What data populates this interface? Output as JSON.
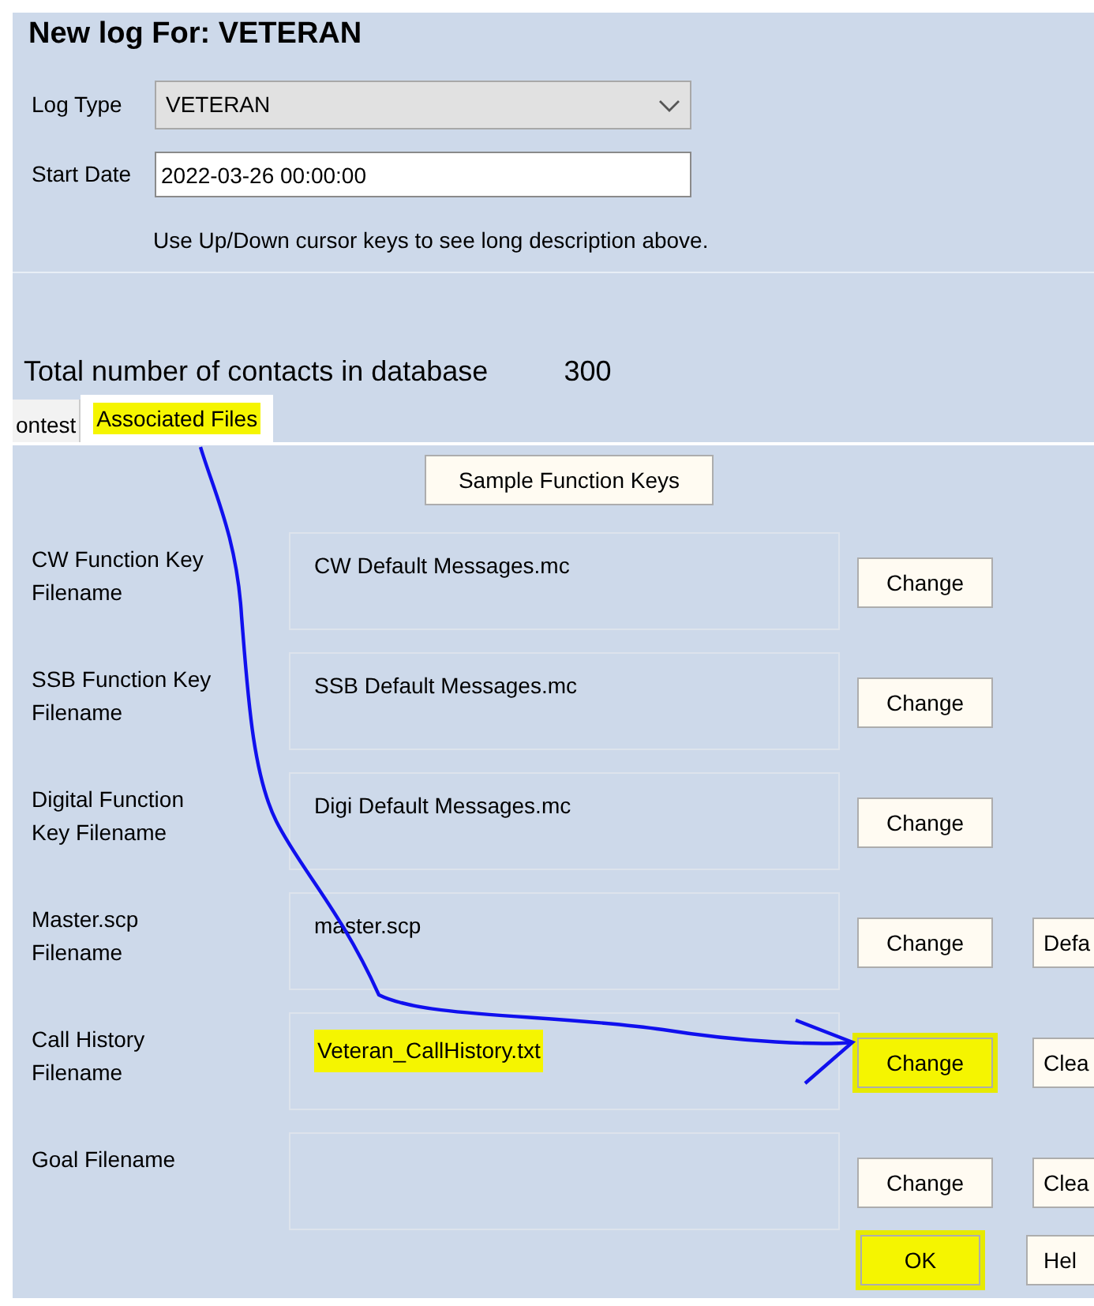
{
  "title": "New log For: VETERAN",
  "log_type": {
    "label": "Log Type",
    "value": "VETERAN"
  },
  "start_date": {
    "label": "Start Date",
    "value": "2022-03-26 00:00:00"
  },
  "hint": "Use Up/Down cursor keys to see long description above.",
  "contacts": {
    "label": "Total number of contacts in database",
    "value": "300"
  },
  "tabs": [
    {
      "label": "ontest",
      "selected": false,
      "highlighted": false
    },
    {
      "label": "Associated Files",
      "selected": true,
      "highlighted": true
    }
  ],
  "sample_button": "Sample Function Keys",
  "files": [
    {
      "label_lines": [
        "CW Function Key",
        "Filename"
      ],
      "value": "CW Default Messages.mc",
      "highlighted": false,
      "change": {
        "label": "Change",
        "highlighted": false
      }
    },
    {
      "label_lines": [
        "SSB Function Key",
        "Filename"
      ],
      "value": "SSB Default Messages.mc",
      "highlighted": false,
      "change": {
        "label": "Change",
        "highlighted": false
      }
    },
    {
      "label_lines": [
        "Digital Function",
        "Key Filename"
      ],
      "value": "Digi Default Messages.mc",
      "highlighted": false,
      "change": {
        "label": "Change",
        "highlighted": false
      }
    },
    {
      "label_lines": [
        "Master.scp",
        "Filename"
      ],
      "value": "master.scp",
      "highlighted": false,
      "change": {
        "label": "Change",
        "highlighted": false
      },
      "extra": "Defa"
    },
    {
      "label_lines": [
        "Call History",
        "Filename"
      ],
      "value": "Veteran_CallHistory.txt",
      "highlighted": true,
      "change": {
        "label": "Change",
        "highlighted": true
      },
      "extra": "Clea"
    },
    {
      "label_lines": [
        "Goal Filename"
      ],
      "change": {
        "label": "Change",
        "highlighted": false
      },
      "extra": "Clea"
    }
  ],
  "footer": [
    {
      "label": "OK",
      "highlighted": true
    },
    {
      "label": "Hel",
      "highlighted": false
    }
  ]
}
